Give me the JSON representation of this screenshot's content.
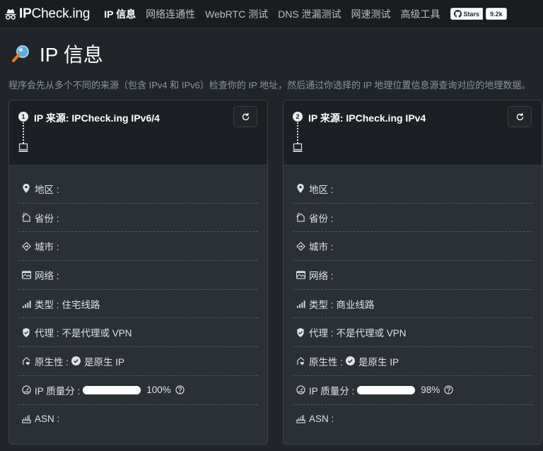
{
  "navbar": {
    "brand_bold": "IP",
    "brand_rest": "Check.ing",
    "items": [
      {
        "label": "IP 信息",
        "active": true
      },
      {
        "label": "网络连通性",
        "active": false
      },
      {
        "label": "WebRTC 测试",
        "active": false
      },
      {
        "label": "DNS 泄漏测试",
        "active": false
      },
      {
        "label": "网速测试",
        "active": false
      },
      {
        "label": "高级工具",
        "active": false
      }
    ],
    "github": {
      "stars_label": "Stars",
      "stars_count": "9.2k"
    }
  },
  "page": {
    "title": "IP 信息",
    "subtitle": "程序会先从多个不同的来源（包含 IPv4 和 IPv6）检查你的 IP 地址，然后通过你选择的 IP 地理位置信息源查询对应的地理数据。"
  },
  "cards": [
    {
      "number": "1",
      "source": "IP 来源: IPCheck.ing IPv6/4",
      "fields": {
        "region": "地区 :",
        "province": "省份 :",
        "city": "城市 :",
        "network": "网络 :",
        "type_label": "类型 :",
        "type_value": "住宅线路",
        "proxy_label": "代理 :",
        "proxy_value": "不是代理或 VPN",
        "native_label": "原生性 :",
        "native_value": "是原生 IP",
        "quality_label": "IP 质量分 :",
        "quality_value": "100%",
        "quality_fraction": 1.0,
        "asn": "ASN :"
      }
    },
    {
      "number": "2",
      "source": "IP 来源: IPCheck.ing IPv4",
      "fields": {
        "region": "地区 :",
        "province": "省份 :",
        "city": "城市 :",
        "network": "网络 :",
        "type_label": "类型 :",
        "type_value": "商业线路",
        "proxy_label": "代理 :",
        "proxy_value": "不是代理或 VPN",
        "native_label": "原生性 :",
        "native_value": "是原生 IP",
        "quality_label": "IP 质量分 :",
        "quality_value": "98%",
        "quality_fraction": 0.98,
        "asn": "ASN :"
      }
    }
  ],
  "icons": {
    "brand": "incognito-icon",
    "title": "magnifier-icon",
    "refresh": "refresh-icon",
    "region": "location-pin-icon",
    "province": "house-icon",
    "city": "signpost-icon",
    "network": "window-icon",
    "type": "signal-bars-icon",
    "proxy": "shield-check-icon",
    "native": "house-heart-icon",
    "quality": "speedometer-icon",
    "asn": "router-icon",
    "github": "github-icon",
    "help": "question-circle-icon",
    "check": "check-circle-icon"
  }
}
